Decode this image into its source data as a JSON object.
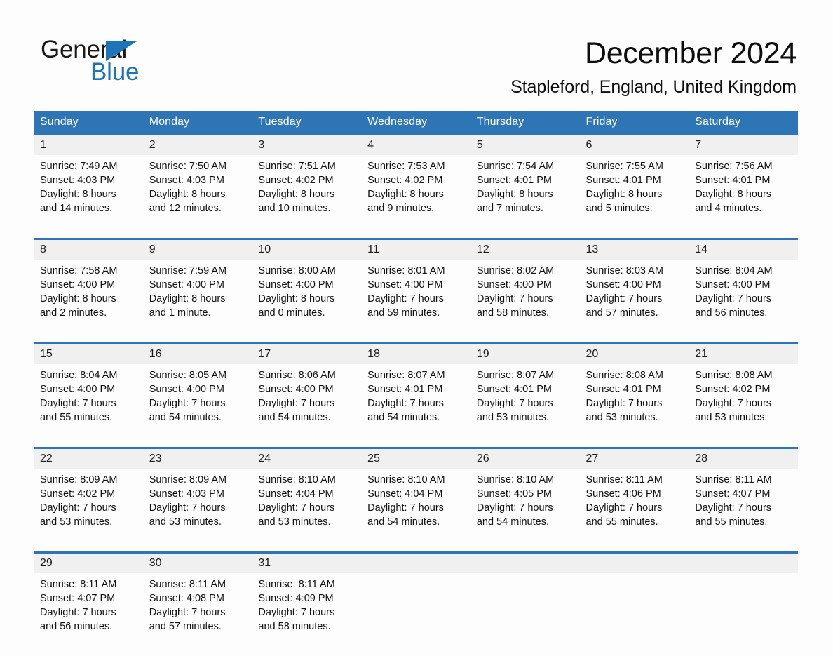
{
  "brand": {
    "name_part1": "General",
    "name_part2": "Blue",
    "accent_color": "#1c74bb",
    "triangle_icon": "brand-triangle-icon"
  },
  "header": {
    "month_title": "December 2024",
    "location": "Stapleford, England, United Kingdom"
  },
  "theme": {
    "header_blue": "#2e75b6",
    "daynum_band": "#f0f0f0",
    "page_background": "#fdfdfd",
    "text": "#111111"
  },
  "calendar": {
    "weekday_headers": [
      "Sunday",
      "Monday",
      "Tuesday",
      "Wednesday",
      "Thursday",
      "Friday",
      "Saturday"
    ],
    "weeks": [
      {
        "daynums": [
          "1",
          "2",
          "3",
          "4",
          "5",
          "6",
          "7"
        ],
        "days": [
          {
            "sunrise": "Sunrise: 7:49 AM",
            "sunset": "Sunset: 4:03 PM",
            "daylight_1": "Daylight: 8 hours",
            "daylight_2": "and 14 minutes."
          },
          {
            "sunrise": "Sunrise: 7:50 AM",
            "sunset": "Sunset: 4:03 PM",
            "daylight_1": "Daylight: 8 hours",
            "daylight_2": "and 12 minutes."
          },
          {
            "sunrise": "Sunrise: 7:51 AM",
            "sunset": "Sunset: 4:02 PM",
            "daylight_1": "Daylight: 8 hours",
            "daylight_2": "and 10 minutes."
          },
          {
            "sunrise": "Sunrise: 7:53 AM",
            "sunset": "Sunset: 4:02 PM",
            "daylight_1": "Daylight: 8 hours",
            "daylight_2": "and 9 minutes."
          },
          {
            "sunrise": "Sunrise: 7:54 AM",
            "sunset": "Sunset: 4:01 PM",
            "daylight_1": "Daylight: 8 hours",
            "daylight_2": "and 7 minutes."
          },
          {
            "sunrise": "Sunrise: 7:55 AM",
            "sunset": "Sunset: 4:01 PM",
            "daylight_1": "Daylight: 8 hours",
            "daylight_2": "and 5 minutes."
          },
          {
            "sunrise": "Sunrise: 7:56 AM",
            "sunset": "Sunset: 4:01 PM",
            "daylight_1": "Daylight: 8 hours",
            "daylight_2": "and 4 minutes."
          }
        ]
      },
      {
        "daynums": [
          "8",
          "9",
          "10",
          "11",
          "12",
          "13",
          "14"
        ],
        "days": [
          {
            "sunrise": "Sunrise: 7:58 AM",
            "sunset": "Sunset: 4:00 PM",
            "daylight_1": "Daylight: 8 hours",
            "daylight_2": "and 2 minutes."
          },
          {
            "sunrise": "Sunrise: 7:59 AM",
            "sunset": "Sunset: 4:00 PM",
            "daylight_1": "Daylight: 8 hours",
            "daylight_2": "and 1 minute."
          },
          {
            "sunrise": "Sunrise: 8:00 AM",
            "sunset": "Sunset: 4:00 PM",
            "daylight_1": "Daylight: 8 hours",
            "daylight_2": "and 0 minutes."
          },
          {
            "sunrise": "Sunrise: 8:01 AM",
            "sunset": "Sunset: 4:00 PM",
            "daylight_1": "Daylight: 7 hours",
            "daylight_2": "and 59 minutes."
          },
          {
            "sunrise": "Sunrise: 8:02 AM",
            "sunset": "Sunset: 4:00 PM",
            "daylight_1": "Daylight: 7 hours",
            "daylight_2": "and 58 minutes."
          },
          {
            "sunrise": "Sunrise: 8:03 AM",
            "sunset": "Sunset: 4:00 PM",
            "daylight_1": "Daylight: 7 hours",
            "daylight_2": "and 57 minutes."
          },
          {
            "sunrise": "Sunrise: 8:04 AM",
            "sunset": "Sunset: 4:00 PM",
            "daylight_1": "Daylight: 7 hours",
            "daylight_2": "and 56 minutes."
          }
        ]
      },
      {
        "daynums": [
          "15",
          "16",
          "17",
          "18",
          "19",
          "20",
          "21"
        ],
        "days": [
          {
            "sunrise": "Sunrise: 8:04 AM",
            "sunset": "Sunset: 4:00 PM",
            "daylight_1": "Daylight: 7 hours",
            "daylight_2": "and 55 minutes."
          },
          {
            "sunrise": "Sunrise: 8:05 AM",
            "sunset": "Sunset: 4:00 PM",
            "daylight_1": "Daylight: 7 hours",
            "daylight_2": "and 54 minutes."
          },
          {
            "sunrise": "Sunrise: 8:06 AM",
            "sunset": "Sunset: 4:00 PM",
            "daylight_1": "Daylight: 7 hours",
            "daylight_2": "and 54 minutes."
          },
          {
            "sunrise": "Sunrise: 8:07 AM",
            "sunset": "Sunset: 4:01 PM",
            "daylight_1": "Daylight: 7 hours",
            "daylight_2": "and 54 minutes."
          },
          {
            "sunrise": "Sunrise: 8:07 AM",
            "sunset": "Sunset: 4:01 PM",
            "daylight_1": "Daylight: 7 hours",
            "daylight_2": "and 53 minutes."
          },
          {
            "sunrise": "Sunrise: 8:08 AM",
            "sunset": "Sunset: 4:01 PM",
            "daylight_1": "Daylight: 7 hours",
            "daylight_2": "and 53 minutes."
          },
          {
            "sunrise": "Sunrise: 8:08 AM",
            "sunset": "Sunset: 4:02 PM",
            "daylight_1": "Daylight: 7 hours",
            "daylight_2": "and 53 minutes."
          }
        ]
      },
      {
        "daynums": [
          "22",
          "23",
          "24",
          "25",
          "26",
          "27",
          "28"
        ],
        "days": [
          {
            "sunrise": "Sunrise: 8:09 AM",
            "sunset": "Sunset: 4:02 PM",
            "daylight_1": "Daylight: 7 hours",
            "daylight_2": "and 53 minutes."
          },
          {
            "sunrise": "Sunrise: 8:09 AM",
            "sunset": "Sunset: 4:03 PM",
            "daylight_1": "Daylight: 7 hours",
            "daylight_2": "and 53 minutes."
          },
          {
            "sunrise": "Sunrise: 8:10 AM",
            "sunset": "Sunset: 4:04 PM",
            "daylight_1": "Daylight: 7 hours",
            "daylight_2": "and 53 minutes."
          },
          {
            "sunrise": "Sunrise: 8:10 AM",
            "sunset": "Sunset: 4:04 PM",
            "daylight_1": "Daylight: 7 hours",
            "daylight_2": "and 54 minutes."
          },
          {
            "sunrise": "Sunrise: 8:10 AM",
            "sunset": "Sunset: 4:05 PM",
            "daylight_1": "Daylight: 7 hours",
            "daylight_2": "and 54 minutes."
          },
          {
            "sunrise": "Sunrise: 8:11 AM",
            "sunset": "Sunset: 4:06 PM",
            "daylight_1": "Daylight: 7 hours",
            "daylight_2": "and 55 minutes."
          },
          {
            "sunrise": "Sunrise: 8:11 AM",
            "sunset": "Sunset: 4:07 PM",
            "daylight_1": "Daylight: 7 hours",
            "daylight_2": "and 55 minutes."
          }
        ]
      },
      {
        "daynums": [
          "29",
          "30",
          "31",
          "",
          "",
          "",
          ""
        ],
        "days": [
          {
            "sunrise": "Sunrise: 8:11 AM",
            "sunset": "Sunset: 4:07 PM",
            "daylight_1": "Daylight: 7 hours",
            "daylight_2": "and 56 minutes."
          },
          {
            "sunrise": "Sunrise: 8:11 AM",
            "sunset": "Sunset: 4:08 PM",
            "daylight_1": "Daylight: 7 hours",
            "daylight_2": "and 57 minutes."
          },
          {
            "sunrise": "Sunrise: 8:11 AM",
            "sunset": "Sunset: 4:09 PM",
            "daylight_1": "Daylight: 7 hours",
            "daylight_2": "and 58 minutes."
          },
          {
            "sunrise": "",
            "sunset": "",
            "daylight_1": "",
            "daylight_2": ""
          },
          {
            "sunrise": "",
            "sunset": "",
            "daylight_1": "",
            "daylight_2": ""
          },
          {
            "sunrise": "",
            "sunset": "",
            "daylight_1": "",
            "daylight_2": ""
          },
          {
            "sunrise": "",
            "sunset": "",
            "daylight_1": "",
            "daylight_2": ""
          }
        ]
      }
    ]
  }
}
